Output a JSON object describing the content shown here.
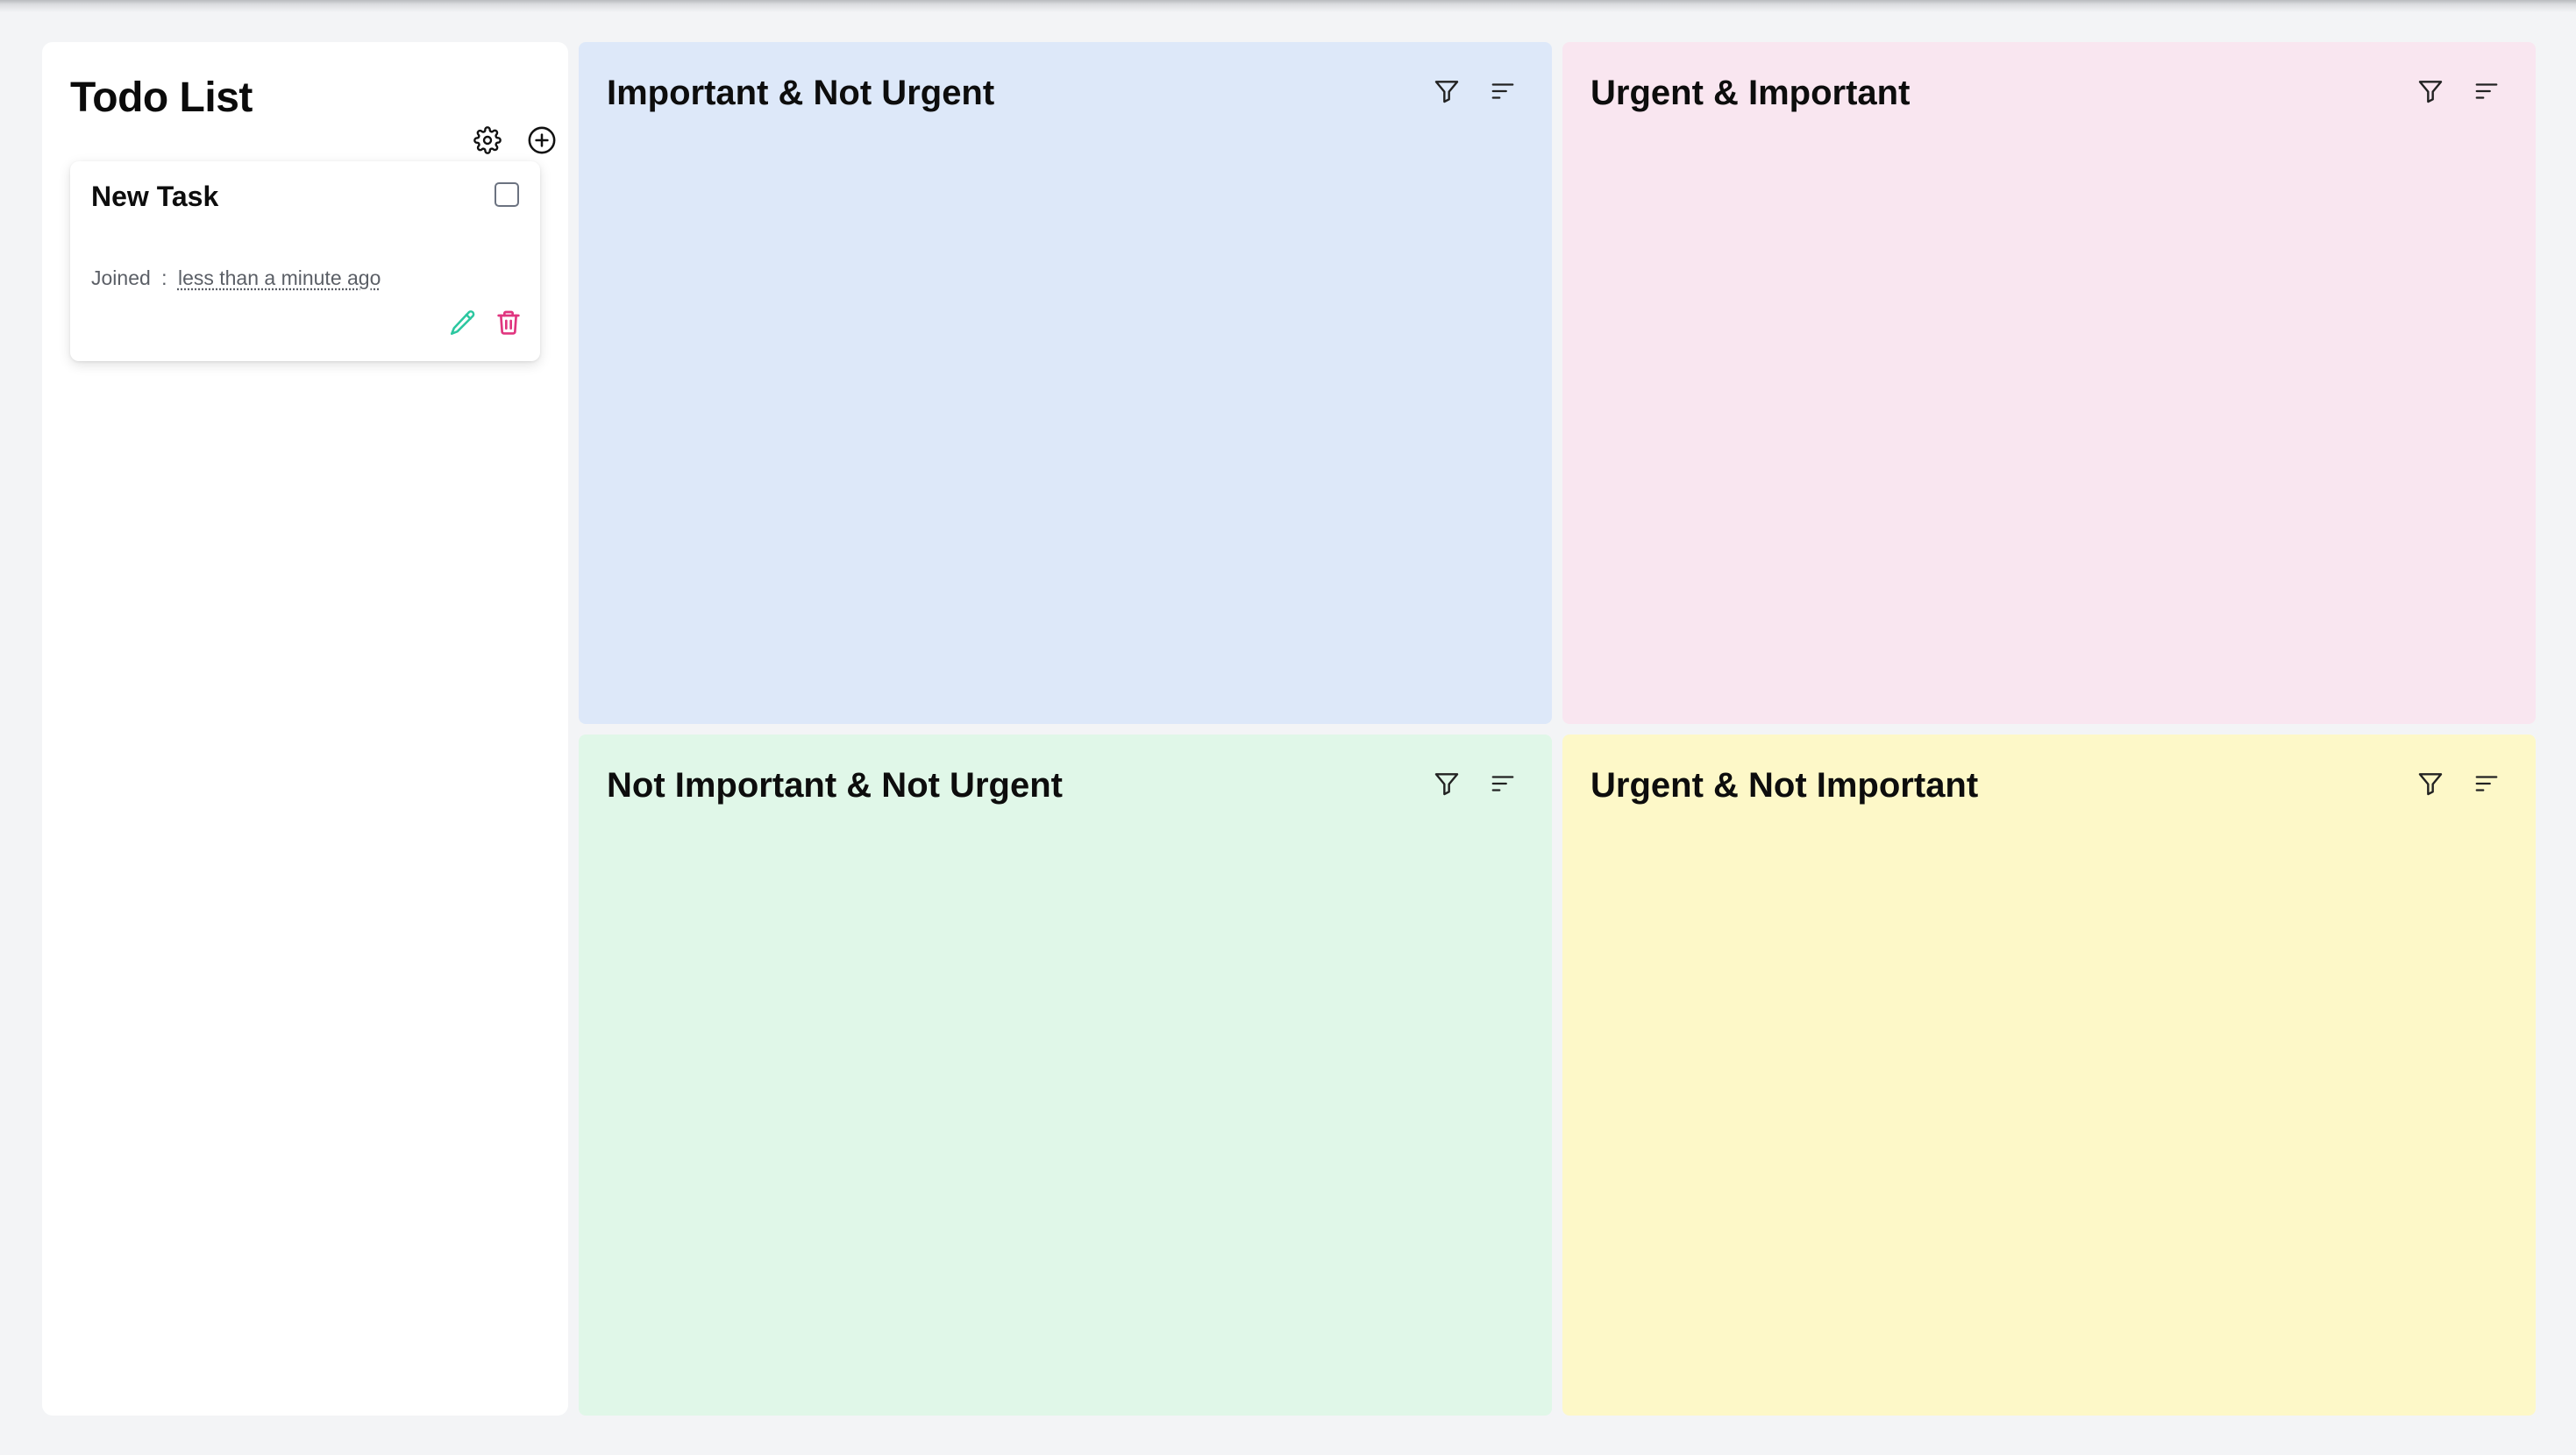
{
  "sidebar": {
    "title": "Todo List",
    "settings_icon": "gear-icon",
    "add_icon": "plus-circle-icon"
  },
  "tasks": [
    {
      "title": "New Task",
      "meta_label": "Joined",
      "meta_separator": ":",
      "meta_time": "less than a minute ago",
      "checked": false,
      "edit_icon": "pencil-icon",
      "delete_icon": "trash-icon"
    }
  ],
  "quadrants": [
    {
      "title": "Important & Not Urgent",
      "background": "#dde8f9",
      "filter_icon": "filter-icon",
      "sort_icon": "sort-icon"
    },
    {
      "title": "Urgent & Important",
      "background": "#f9e6f0",
      "filter_icon": "filter-icon",
      "sort_icon": "sort-icon"
    },
    {
      "title": "Not Important & Not Urgent",
      "background": "#e0f7e8",
      "filter_icon": "filter-icon",
      "sort_icon": "sort-icon"
    },
    {
      "title": "Urgent & Not Important",
      "background": "#fdf8c8",
      "filter_icon": "filter-icon",
      "sort_icon": "sort-icon"
    }
  ],
  "colors": {
    "edit_accent": "#2cc7a0",
    "delete_accent": "#e0357f",
    "page_background": "#f3f4f6"
  }
}
